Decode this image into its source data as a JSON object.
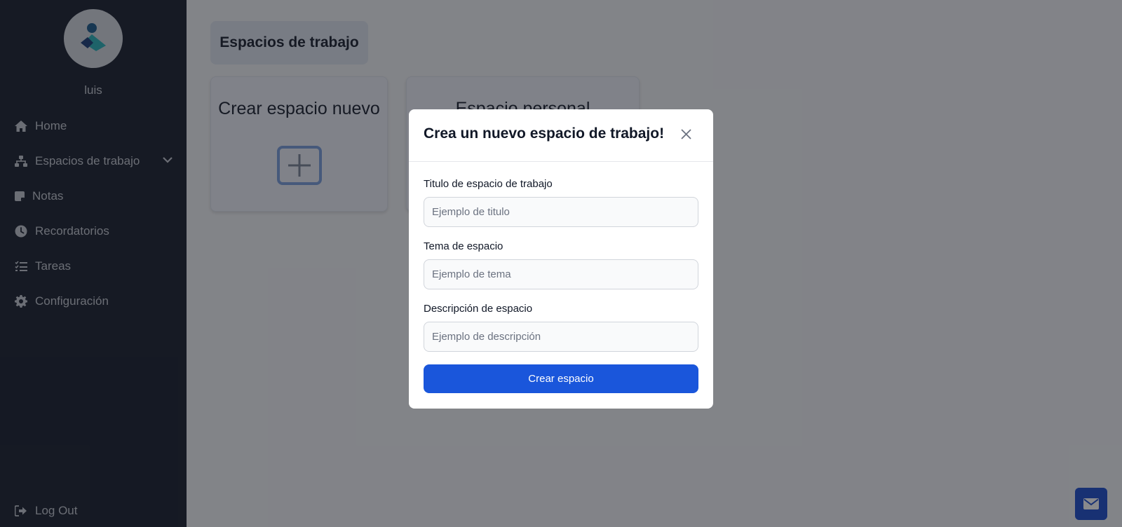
{
  "sidebar": {
    "username": "luis",
    "items": [
      {
        "label": "Home",
        "icon": "home-icon"
      },
      {
        "label": "Espacios de trabajo",
        "icon": "sitemap-icon"
      },
      {
        "label": "Notas",
        "icon": "note-icon"
      },
      {
        "label": "Recordatorios",
        "icon": "clock-icon"
      },
      {
        "label": "Tareas",
        "icon": "task-list-icon"
      },
      {
        "label": "Configuración",
        "icon": "gear-icon"
      }
    ],
    "logout_label": "Log Out"
  },
  "main": {
    "header": "Espacios de trabajo",
    "cards": [
      {
        "title": "Crear espacio nuevo"
      },
      {
        "title": "Espacio personal"
      }
    ]
  },
  "modal": {
    "title": "Crea un nuevo espacio de trabajo!",
    "fields": [
      {
        "label": "Titulo de espacio de trabajo",
        "placeholder": "Ejemplo de titulo",
        "value": ""
      },
      {
        "label": "Tema de espacio",
        "placeholder": "Ejemplo de tema",
        "value": ""
      },
      {
        "label": "Descripción de espacio",
        "placeholder": "Ejemplo de descripción",
        "value": ""
      }
    ],
    "submit_label": "Crear espacio"
  },
  "colors": {
    "sidebar_bg": "#1a202f",
    "primary": "#1a56db",
    "overlay": "rgba(17,19,26,0.5)"
  }
}
